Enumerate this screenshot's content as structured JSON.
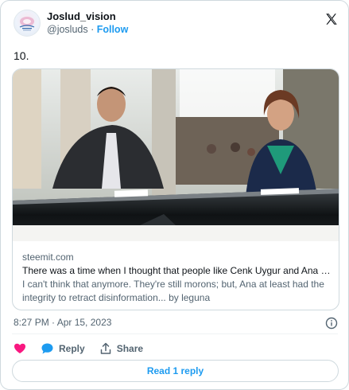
{
  "author": {
    "display_name": "Joslud_vision",
    "handle": "@josluds",
    "separator": " · ",
    "follow_label": "Follow"
  },
  "tweet": {
    "text": "10."
  },
  "link_card": {
    "domain": "steemit.com",
    "title": "There was a time when I thought that people like Cenk Uygur and Ana K...",
    "description": "I can't think that anymore. They're still morons; but, Ana at least had the integrity to retract disinformation... by leguna"
  },
  "meta": {
    "timestamp": "8:27 PM · Apr 15, 2023"
  },
  "actions": {
    "reply_label": "Reply",
    "share_label": "Share"
  },
  "read_replies_label": "Read 1 reply",
  "icons": {
    "brand": "x-logo-icon",
    "info": "info-icon",
    "like": "heart-icon",
    "reply": "speech-bubble-icon",
    "share": "share-arrow-icon"
  },
  "colors": {
    "accent": "#1d9bf0",
    "like": "#f91880",
    "text": "#0f1419",
    "muted": "#536471",
    "border": "#cfd9de"
  }
}
